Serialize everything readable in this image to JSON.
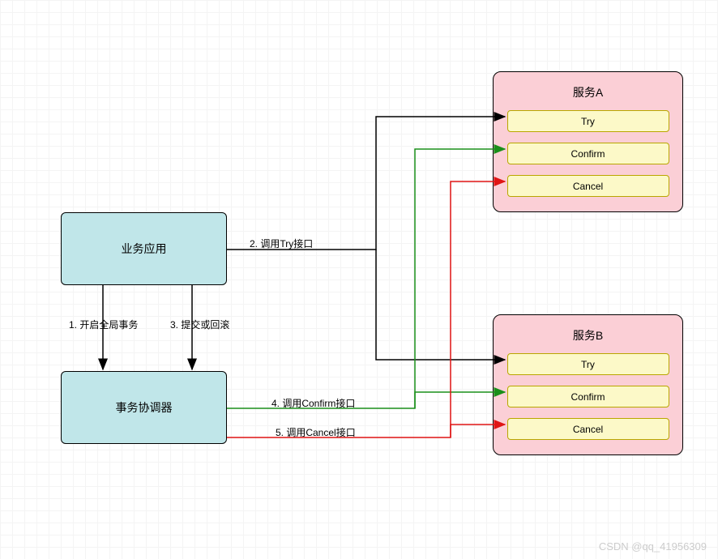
{
  "nodes": {
    "business_app": {
      "label": "业务应用"
    },
    "tx_coordinator": {
      "label": "事务协调器"
    },
    "serviceA": {
      "title": "服务A",
      "try": "Try",
      "confirm": "Confirm",
      "cancel": "Cancel"
    },
    "serviceB": {
      "title": "服务B",
      "try": "Try",
      "confirm": "Confirm",
      "cancel": "Cancel"
    }
  },
  "edges": {
    "e1": "1. 开启全局事务",
    "e2": "2. 调用Try接口",
    "e3": "3. 提交或回滚",
    "e4": "4. 调用Confirm接口",
    "e5": "5. 调用Cancel接口"
  },
  "watermark": "CSDN @qq_41956309",
  "chart_data": {
    "type": "diagram",
    "title": "TCC distributed transaction flow",
    "nodes": [
      {
        "id": "business_app",
        "label": "业务应用",
        "kind": "process"
      },
      {
        "id": "tx_coordinator",
        "label": "事务协调器",
        "kind": "process"
      },
      {
        "id": "serviceA",
        "label": "服务A",
        "kind": "service",
        "ops": [
          "Try",
          "Confirm",
          "Cancel"
        ]
      },
      {
        "id": "serviceB",
        "label": "服务B",
        "kind": "service",
        "ops": [
          "Try",
          "Confirm",
          "Cancel"
        ]
      }
    ],
    "edges": [
      {
        "from": "business_app",
        "to": "tx_coordinator",
        "label": "1. 开启全局事务",
        "color": "black"
      },
      {
        "from": "business_app",
        "to": [
          "serviceA.Try",
          "serviceB.Try"
        ],
        "label": "2. 调用Try接口",
        "color": "black"
      },
      {
        "from": "business_app",
        "to": "tx_coordinator",
        "label": "3. 提交或回滚",
        "color": "black"
      },
      {
        "from": "tx_coordinator",
        "to": [
          "serviceA.Confirm",
          "serviceB.Confirm"
        ],
        "label": "4. 调用Confirm接口",
        "color": "green"
      },
      {
        "from": "tx_coordinator",
        "to": [
          "serviceA.Cancel",
          "serviceB.Cancel"
        ],
        "label": "5. 调用Cancel接口",
        "color": "red"
      }
    ],
    "colors": {
      "process_fill": "#c0e6e9",
      "service_fill": "#fbcfd6",
      "operation_fill": "#fcf9c8",
      "try_arrow": "#000000",
      "confirm_arrow": "#1a8f1a",
      "cancel_arrow": "#e01515"
    }
  }
}
